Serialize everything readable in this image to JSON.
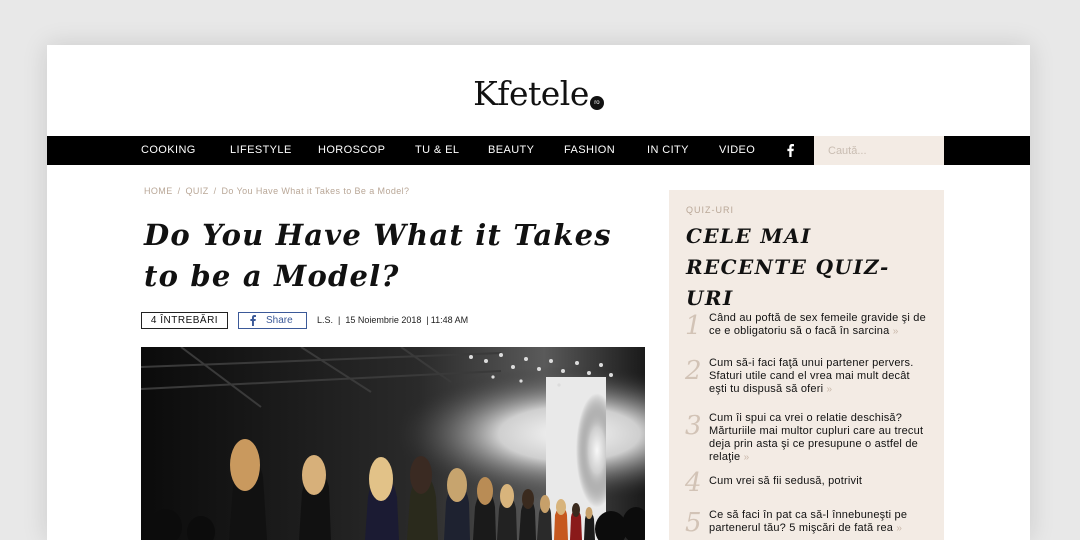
{
  "logo": {
    "name": "Kfetele",
    "badge": "ro"
  },
  "nav": {
    "items": [
      "COOKING",
      "LIFESTYLE",
      "HOROSCOP",
      "TU & EL",
      "BEAUTY",
      "FASHION",
      "IN CITY",
      "VIDEO"
    ],
    "social_icon": "facebook-icon",
    "search_placeholder": "Caută..."
  },
  "breadcrumb": {
    "home": "HOME",
    "quiz": "QUIZ",
    "current": "Do You Have What it Takes to Be a Model?"
  },
  "article": {
    "title": "Do You Have What it Takes to be a Model?",
    "questions_badge": "4 ÎNTREBĂRI",
    "share_label": "Share",
    "author": "L.S.",
    "date": "15 Noiembrie 2018",
    "time": "11:48 AM",
    "hero_image": "fashion runway photo with models walking under stage lights"
  },
  "sidebar": {
    "kicker": "QUIZ-URI",
    "title": "CELE MAI RECENTE QUIZ-URI",
    "items": [
      {
        "num": "1",
        "text": "Când au poftă de sex femeile gravide şi de ce e obligatoriu să o facă în sarcina"
      },
      {
        "num": "2",
        "text": "Cum să-i faci faţă unui partener pervers. Sfaturi utile cand el vrea mai mult decât eşti tu dispusă să oferi"
      },
      {
        "num": "3",
        "text": "Cum îi spui ca vrei o relatie deschisă? Mărturiile mai multor cupluri care au trecut deja prin asta şi ce presupune o astfel de relaţie"
      },
      {
        "num": "4",
        "text": "Cum vrei să fii sedusă, potrivit"
      },
      {
        "num": "5",
        "text": "Ce să faci în pat ca să-l înnebuneşti pe partenerul tău? 5 mişcări de fată rea"
      }
    ],
    "arrow": "»"
  },
  "colors": {
    "nav_bg": "#000000",
    "sidebar_bg": "#f3ebe4",
    "muted_accent": "#b9a797",
    "facebook_blue": "#3b5998"
  }
}
